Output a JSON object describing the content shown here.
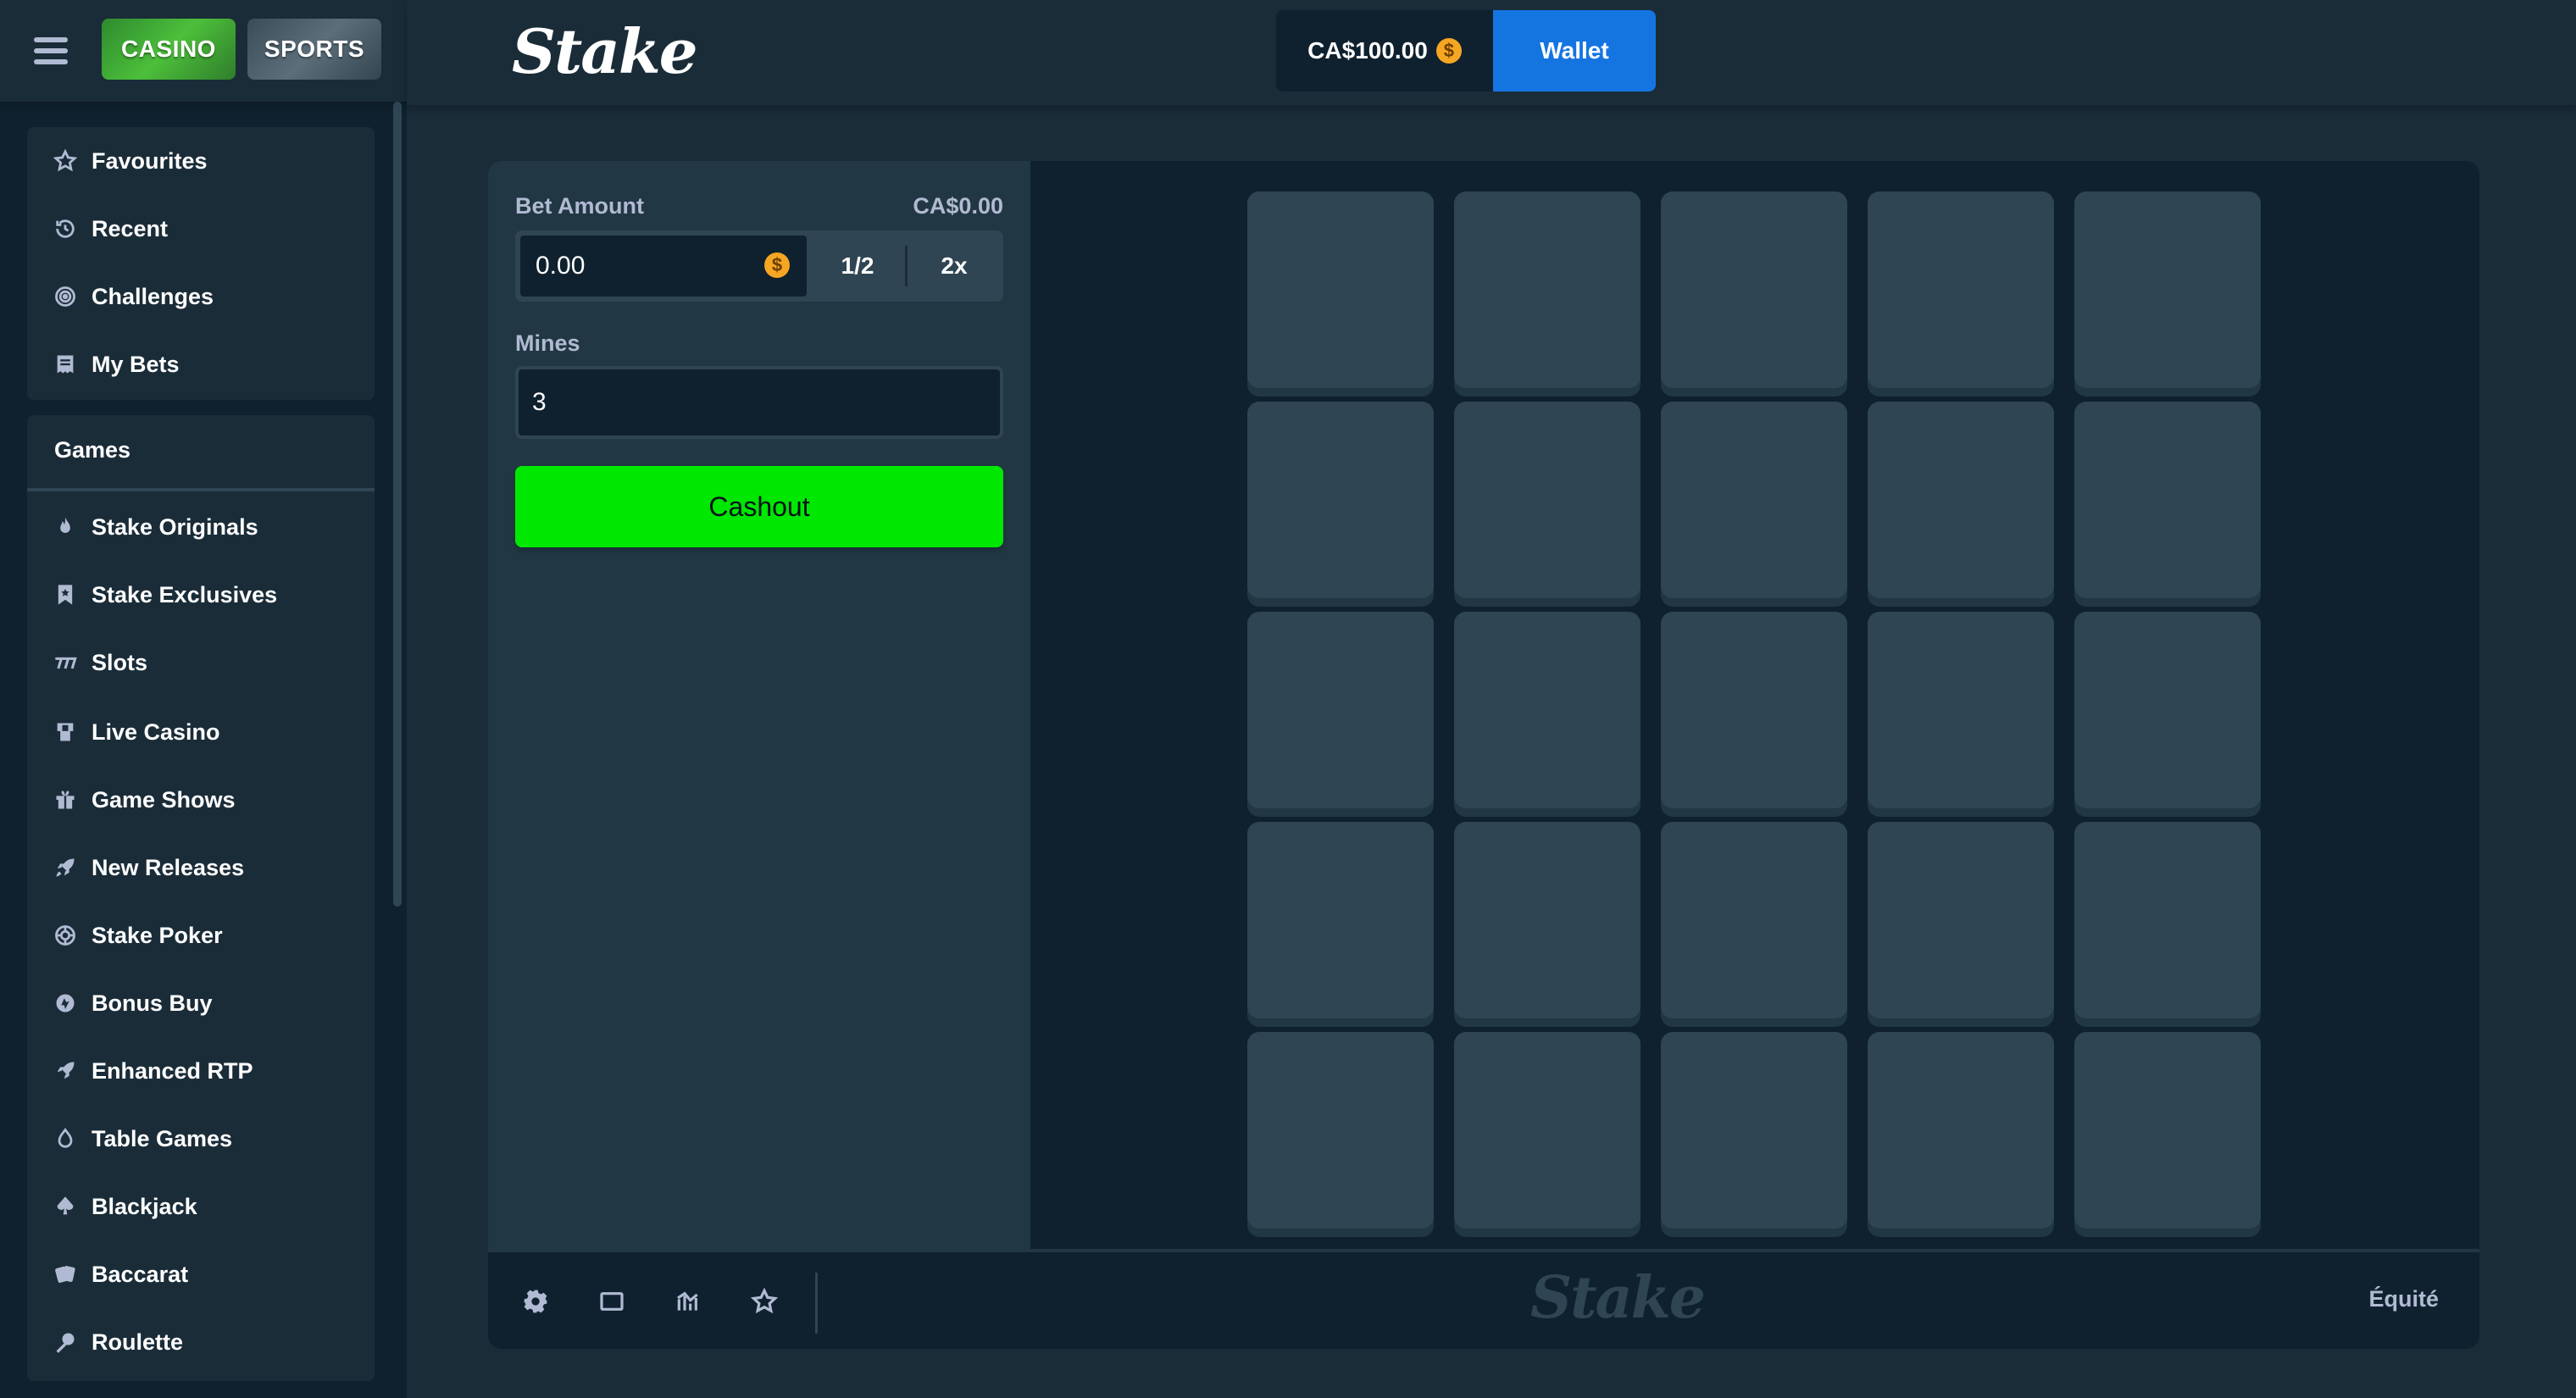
{
  "header": {
    "modes": [
      "CASINO",
      "SPORTS"
    ],
    "logo": "Stake",
    "balance": "CA$100.00",
    "coin_symbol": "$",
    "wallet_label": "Wallet"
  },
  "sidebar": {
    "top_items": [
      "Favourites",
      "Recent",
      "Challenges",
      "My Bets"
    ],
    "games_heading": "Games",
    "game_items": [
      "Stake Originals",
      "Stake Exclusives",
      "Slots",
      "Live Casino",
      "Game Shows",
      "New Releases",
      "Stake Poker",
      "Bonus Buy",
      "Enhanced RTP",
      "Table Games",
      "Blackjack",
      "Baccarat",
      "Roulette"
    ]
  },
  "panel": {
    "bet_amount_label": "Bet Amount",
    "bet_amount_display": "CA$0.00",
    "bet_value": "0.00",
    "half_label": "1/2",
    "double_label": "2x",
    "mines_label": "Mines",
    "mines_value": "3",
    "cashout_label": "Cashout"
  },
  "board": {
    "rows": 5,
    "cols": 5
  },
  "footer": {
    "logo": "Stake",
    "fairness_label": "Équité"
  },
  "colors": {
    "bg": "#1a2c38",
    "dark": "#0f212e",
    "panel": "#213743",
    "tile": "#2f4553",
    "accent_green": "#00e701",
    "wallet_blue": "#1475e1"
  }
}
